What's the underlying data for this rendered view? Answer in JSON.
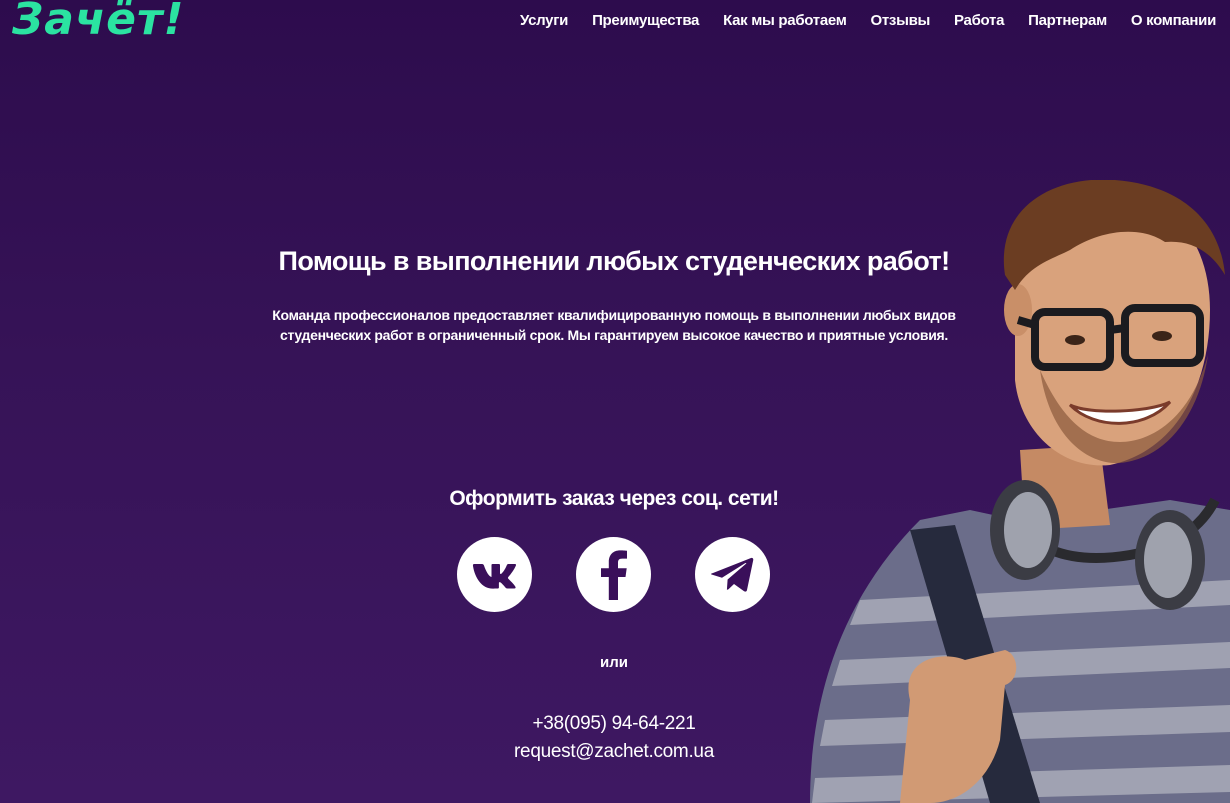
{
  "brand": {
    "logo_text": "Зачёт!",
    "accent_color": "#2be3a1"
  },
  "nav": {
    "items": [
      {
        "label": "Услуги"
      },
      {
        "label": "Преимущества"
      },
      {
        "label": "Как мы работаем"
      },
      {
        "label": "Отзывы"
      },
      {
        "label": "Работа"
      },
      {
        "label": "Партнерам"
      },
      {
        "label": "О компании"
      }
    ]
  },
  "hero": {
    "title": "Помощь в выполнении любых студенческих работ!",
    "text": "Команда профессионалов предоставляет квалифицированную помощь в выполнении любых видов студенческих работ в ограниченный срок. Мы гарантируем высокое качество и приятные условия."
  },
  "social": {
    "title": "Оформить заказ через соц. сети!",
    "buttons": [
      {
        "icon": "vk-icon"
      },
      {
        "icon": "facebook-icon"
      },
      {
        "icon": "telegram-icon"
      }
    ],
    "or_label": "или"
  },
  "contacts": {
    "phone": "+38(095) 94-64-221",
    "email": "request@zachet.com.ua"
  },
  "colors": {
    "background_top": "#2d0c4d",
    "background_bottom": "#3e1862",
    "icon_color": "#3a0f5a"
  }
}
